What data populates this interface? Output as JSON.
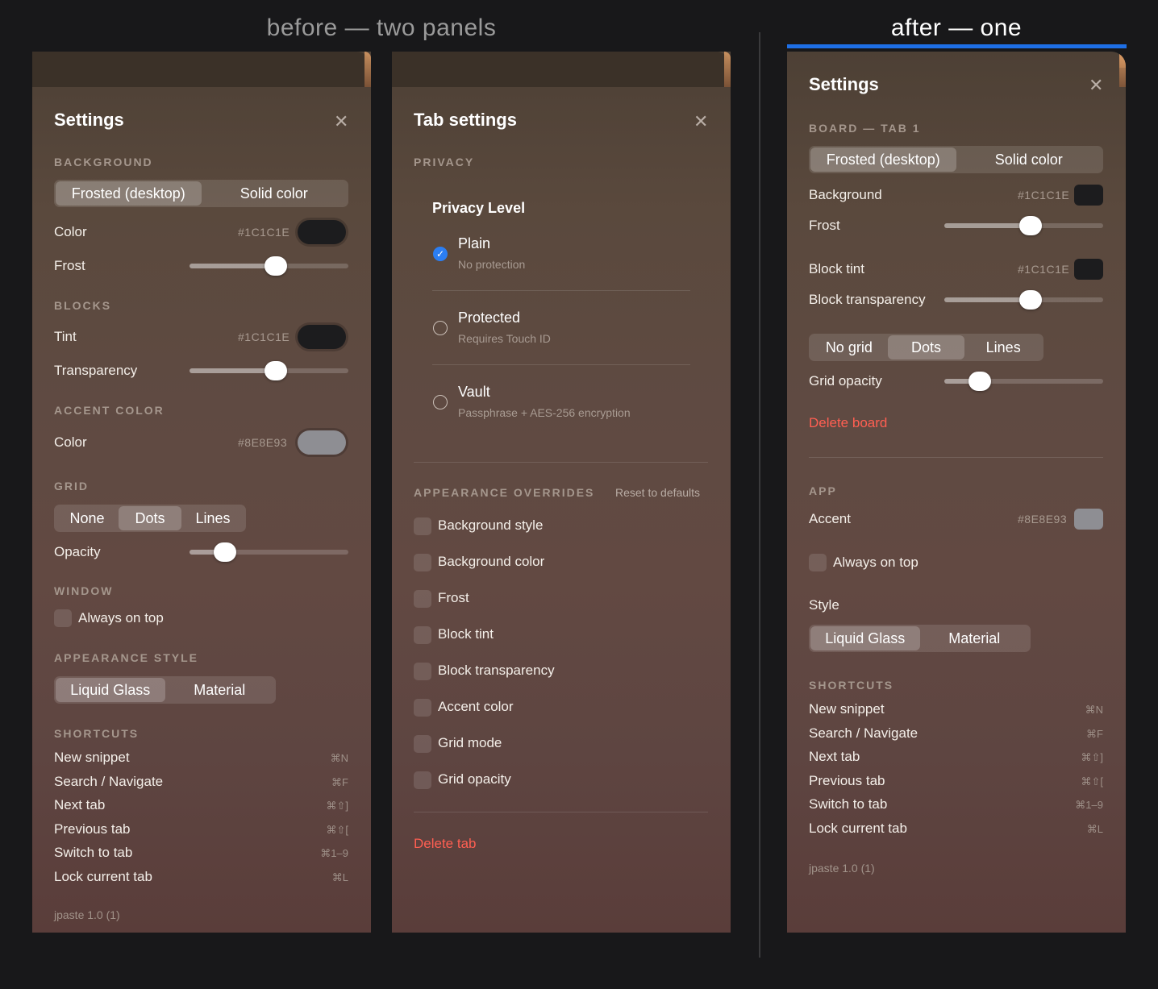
{
  "headings": {
    "before": "before — two panels",
    "after": "after — one"
  },
  "panel1": {
    "title": "Settings",
    "background": {
      "section": "BACKGROUND",
      "segments": [
        "Frosted (desktop)",
        "Solid color"
      ],
      "color_label": "Color",
      "color_hex": "#1C1C1E",
      "frost_label": "Frost",
      "frost_value": 0.55
    },
    "blocks": {
      "section": "BLOCKS",
      "tint_label": "Tint",
      "tint_hex": "#1C1C1E",
      "transparency_label": "Transparency",
      "transparency_value": 0.55
    },
    "accent": {
      "section": "ACCENT COLOR",
      "color_label": "Color",
      "color_hex": "#8E8E93"
    },
    "grid": {
      "section": "GRID",
      "segments": [
        "None",
        "Dots",
        "Lines"
      ],
      "selected": 1,
      "opacity_label": "Opacity",
      "opacity_value": 0.18
    },
    "window": {
      "section": "WINDOW",
      "always_on_top": "Always on top"
    },
    "appearance": {
      "section": "APPEARANCE STYLE",
      "segments": [
        "Liquid Glass",
        "Material"
      ]
    },
    "shortcuts": {
      "section": "SHORTCUTS",
      "items": [
        {
          "label": "New snippet",
          "key": "⌘N"
        },
        {
          "label": "Search / Navigate",
          "key": "⌘F"
        },
        {
          "label": "Next tab",
          "key": "⌘⇧]"
        },
        {
          "label": "Previous tab",
          "key": "⌘⇧["
        },
        {
          "label": "Switch to tab",
          "key": "⌘1–9"
        },
        {
          "label": "Lock current tab",
          "key": "⌘L"
        }
      ]
    },
    "version": "jpaste 1.0 (1)"
  },
  "panel2": {
    "title": "Tab settings",
    "privacy": {
      "section": "PRIVACY",
      "level_title": "Privacy Level",
      "options": [
        {
          "title": "Plain",
          "sub": "No protection",
          "selected": true
        },
        {
          "title": "Protected",
          "sub": "Requires Touch ID",
          "selected": false
        },
        {
          "title": "Vault",
          "sub": "Passphrase + AES-256 encryption",
          "selected": false
        }
      ]
    },
    "overrides": {
      "section": "APPEARANCE OVERRIDES",
      "reset": "Reset to defaults",
      "items": [
        "Background style",
        "Background color",
        "Frost",
        "Block tint",
        "Block transparency",
        "Accent color",
        "Grid mode",
        "Grid opacity"
      ]
    },
    "delete": "Delete tab"
  },
  "panel3": {
    "title": "Settings",
    "board_section": "BOARD — TAB 1",
    "segments": [
      "Frosted (desktop)",
      "Solid color"
    ],
    "background_label": "Background",
    "background_hex": "#1C1C1E",
    "frost_label": "Frost",
    "frost_value": 0.55,
    "block_tint_label": "Block tint",
    "block_tint_hex": "#1C1C1E",
    "block_transparency_label": "Block transparency",
    "block_transparency_value": 0.55,
    "grid_segments": [
      "No grid",
      "Dots",
      "Lines"
    ],
    "grid_selected": 1,
    "grid_opacity_label": "Grid opacity",
    "grid_opacity_value": 0.18,
    "delete": "Delete board",
    "app_section": "APP",
    "accent_label": "Accent",
    "accent_hex": "#8E8E93",
    "always_on_top": "Always on top",
    "style_label": "Style",
    "style_segments": [
      "Liquid Glass",
      "Material"
    ],
    "shortcuts": {
      "section": "SHORTCUTS",
      "items": [
        {
          "label": "New snippet",
          "key": "⌘N"
        },
        {
          "label": "Search / Navigate",
          "key": "⌘F"
        },
        {
          "label": "Next tab",
          "key": "⌘⇧]"
        },
        {
          "label": "Previous tab",
          "key": "⌘⇧["
        },
        {
          "label": "Switch to tab",
          "key": "⌘1–9"
        },
        {
          "label": "Lock current tab",
          "key": "⌘L"
        }
      ]
    },
    "version": "jpaste 1.0 (1)"
  },
  "colors": {
    "accent_blue": "#1E6FE6",
    "danger": "#FF5F52",
    "swatch_dark": "#1C1C1E",
    "swatch_grey": "#8E8E93"
  }
}
